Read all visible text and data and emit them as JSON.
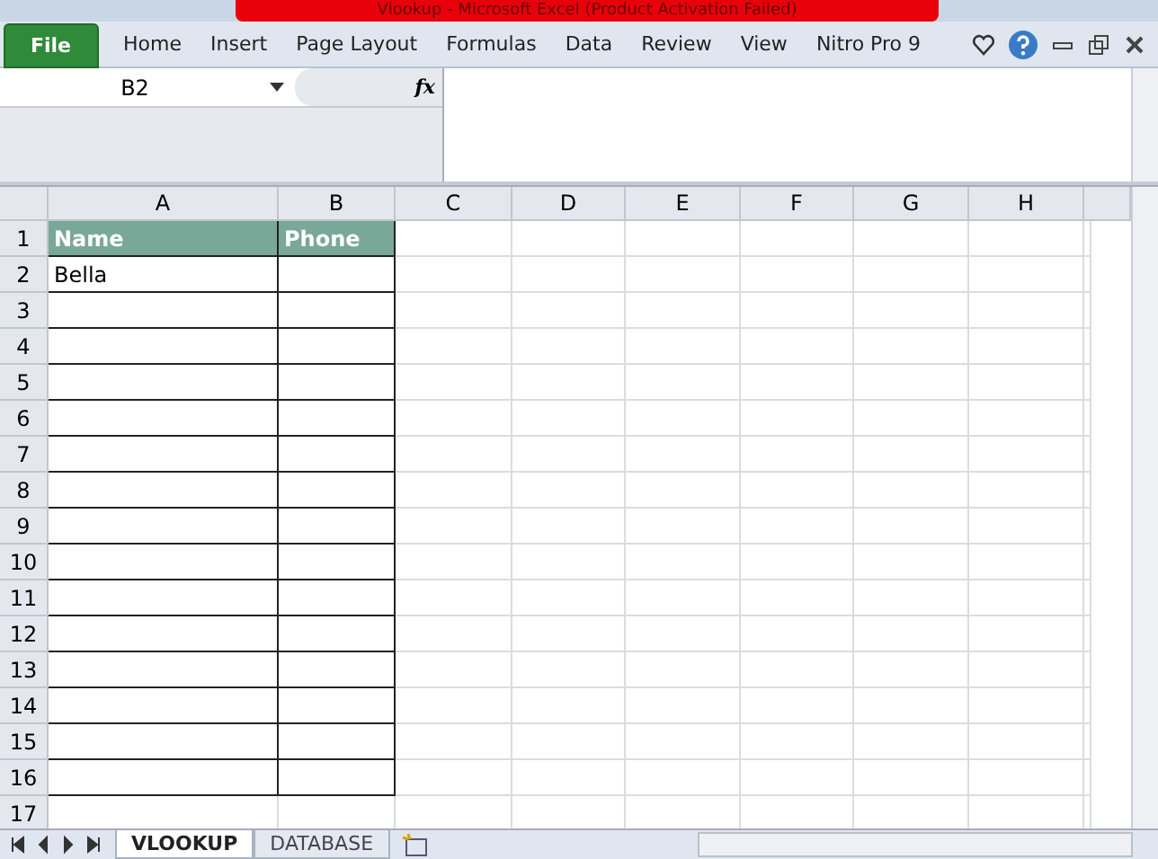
{
  "window": {
    "title": "Vlookup - Microsoft Excel (Product Activation Failed)"
  },
  "ribbon": {
    "file_tab": "File",
    "tabs": [
      "Home",
      "Insert",
      "Page Layout",
      "Formulas",
      "Data",
      "Review",
      "View",
      "Nitro Pro 9"
    ]
  },
  "formula_bar": {
    "name_box": "B2",
    "fx_label": "fx"
  },
  "sheet": {
    "columns": [
      "A",
      "B",
      "C",
      "D",
      "E",
      "F",
      "G",
      "H"
    ],
    "rows": [
      {
        "number": "1",
        "kind": "header",
        "cells": [
          "Name",
          "Phone"
        ]
      },
      {
        "number": "2",
        "kind": "table",
        "cells": [
          "Bella",
          ""
        ]
      },
      {
        "number": "3",
        "kind": "table",
        "cells": [
          "",
          ""
        ]
      },
      {
        "number": "4",
        "kind": "table",
        "cells": [
          "",
          ""
        ]
      },
      {
        "number": "5",
        "kind": "table",
        "cells": [
          "",
          ""
        ]
      },
      {
        "number": "6",
        "kind": "table",
        "cells": [
          "",
          ""
        ]
      },
      {
        "number": "7",
        "kind": "table",
        "cells": [
          "",
          ""
        ]
      },
      {
        "number": "8",
        "kind": "table",
        "cells": [
          "",
          ""
        ]
      },
      {
        "number": "9",
        "kind": "table",
        "cells": [
          "",
          ""
        ]
      },
      {
        "number": "10",
        "kind": "table",
        "cells": [
          "",
          ""
        ]
      },
      {
        "number": "11",
        "kind": "table",
        "cells": [
          "",
          ""
        ]
      },
      {
        "number": "12",
        "kind": "table",
        "cells": [
          "",
          ""
        ]
      },
      {
        "number": "13",
        "kind": "table",
        "cells": [
          "",
          ""
        ]
      },
      {
        "number": "14",
        "kind": "table",
        "cells": [
          "",
          ""
        ]
      },
      {
        "number": "15",
        "kind": "table",
        "cells": [
          "",
          ""
        ]
      },
      {
        "number": "16",
        "kind": "table",
        "cells": [
          "",
          ""
        ]
      },
      {
        "number": "17",
        "kind": "plain",
        "cells": [
          "",
          ""
        ]
      }
    ]
  },
  "sheet_tabs": [
    {
      "label": "VLOOKUP",
      "selected": true
    },
    {
      "label": "DATABASE",
      "selected": false
    }
  ]
}
